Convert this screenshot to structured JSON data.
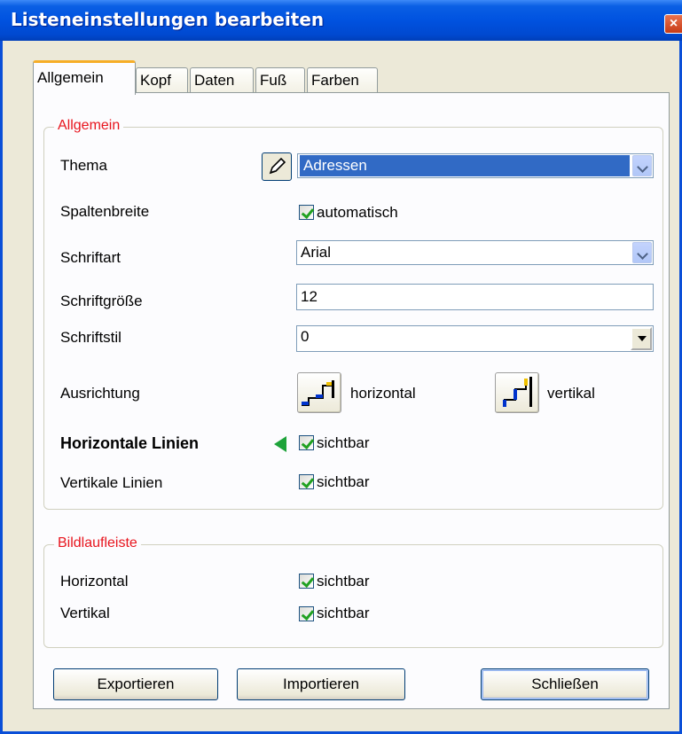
{
  "window": {
    "title": "Listeneinstellungen bearbeiten",
    "close_label": "×"
  },
  "tabs": [
    {
      "label": "Allgemein"
    },
    {
      "label": "Kopf"
    },
    {
      "label": "Daten"
    },
    {
      "label": "Fuß"
    },
    {
      "label": "Farben"
    }
  ],
  "general": {
    "title": "Allgemein",
    "thema": {
      "label": "Thema",
      "value": "Adressen",
      "edit_icon": "pen-icon"
    },
    "spaltenbreite": {
      "label": "Spaltenbreite",
      "checkbox_label": "automatisch",
      "checked": true
    },
    "schriftart": {
      "label": "Schriftart",
      "value": "Arial"
    },
    "schriftgroesse": {
      "label": "Schriftgröße",
      "value": "12"
    },
    "schriftstil": {
      "label": "Schriftstil",
      "value": "0"
    },
    "ausrichtung": {
      "label": "Ausrichtung",
      "horizontal_label": "horizontal",
      "vertikal_label": "vertikal"
    },
    "horizontale_linien": {
      "label": "Horizontale Linien",
      "checkbox_label": "sichtbar",
      "checked": true
    },
    "vertikale_linien": {
      "label": "Vertikale Linien",
      "checkbox_label": "sichtbar",
      "checked": true
    }
  },
  "scrollbar": {
    "title": "Bildlaufleiste",
    "horizontal": {
      "label": "Horizontal",
      "checkbox_label": "sichtbar",
      "checked": true
    },
    "vertikal": {
      "label": "Vertikal",
      "checkbox_label": "sichtbar",
      "checked": true
    }
  },
  "buttons": {
    "export": "Exportieren",
    "import": "Importieren",
    "close": "Schließen"
  },
  "colors": {
    "group_title": "#e8151e",
    "selection": "#316ac5",
    "titlebar": "#0052e0",
    "marker": "#1ea33a"
  }
}
